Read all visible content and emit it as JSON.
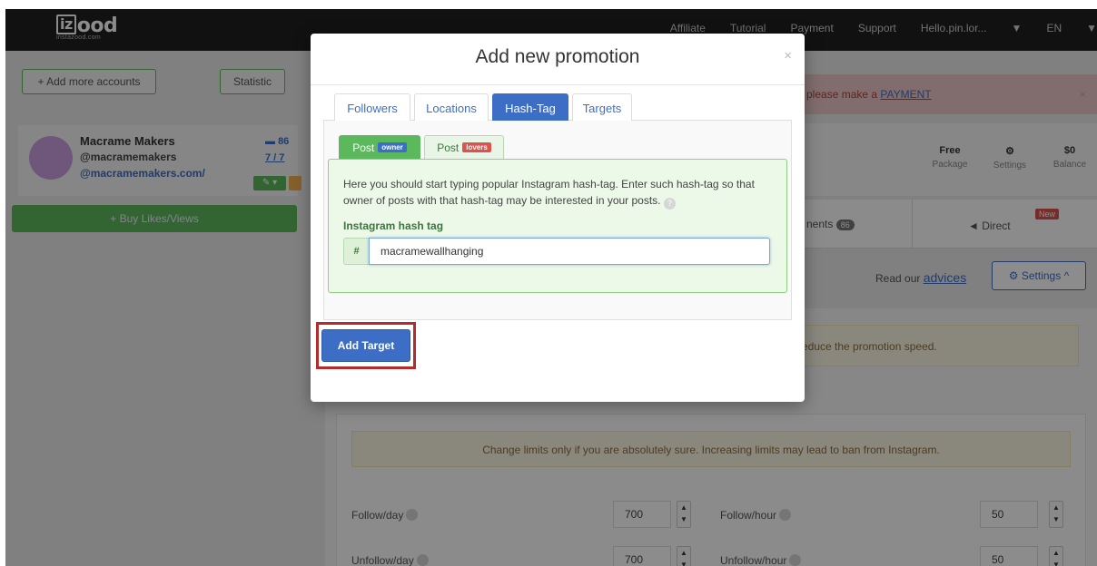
{
  "brand": {
    "logo_box": "iz",
    "logo_text": "ood",
    "subtitle": "instazood.com"
  },
  "topnav": {
    "links": [
      "Affiliate",
      "Tutorial",
      "Payment",
      "Support",
      "Hello.pin.lor...",
      "EN"
    ]
  },
  "sidebar": {
    "add_accounts_label": "+ Add more accounts",
    "statistic_label": "Statistic",
    "account": {
      "name": "Macrame Makers",
      "handle": "@macramemakers",
      "link": "@macramemakers.com/",
      "message_count": "86",
      "ratio": "7 / 7"
    },
    "buy_label": "+ Buy Likes/Views"
  },
  "main": {
    "alert_text": "please make a",
    "alert_link": "PAYMENT",
    "alert_close": "×",
    "stats": [
      {
        "value": "Free",
        "label": "Package"
      },
      {
        "value": "⚙",
        "label": "Settings"
      },
      {
        "value": "$0",
        "label": "Balance"
      }
    ],
    "tab_comments_partial": "nents",
    "tab_comments_count": "86",
    "tab_direct": "Direct",
    "tab_direct_badge": "New",
    "read_advices_prefix": "Read our",
    "read_advices_link": "advices",
    "settings_label": "⚙ Settings ^",
    "speed_warning_partial": "educe the promotion speed.",
    "limits_warning": "Change limits only if you are absolutely sure. Increasing limits may lead to ban from Instagram.",
    "limits": [
      {
        "label": "Follow/day",
        "value": "700"
      },
      {
        "label": "Follow/hour",
        "value": "50"
      },
      {
        "label": "Unfollow/day",
        "value": "700"
      },
      {
        "label": "Unfollow/hour",
        "value": "50"
      }
    ]
  },
  "modal": {
    "title": "Add new promotion",
    "close": "×",
    "tabs": [
      "Followers",
      "Locations",
      "Hash-Tag",
      "Targets"
    ],
    "active_tab": "Hash-Tag",
    "post_tabs": [
      {
        "label": "Post",
        "tag": "owner"
      },
      {
        "label": "Post",
        "tag": "lovers"
      }
    ],
    "help_text": "Here you should start typing popular Instagram hash-tag. Enter such hash-tag so that owner of posts with that hash-tag may be interested in your posts.",
    "help_icon": "?",
    "field_label": "Instagram hash tag",
    "addon": "#",
    "hash_value": "macramewallhanging",
    "add_button": "Add Target"
  },
  "colors": {
    "primary": "#3d6ec5",
    "success": "#5cb85c",
    "highlight": "#b52a2a",
    "nav_bg": "#1f1f1f"
  }
}
